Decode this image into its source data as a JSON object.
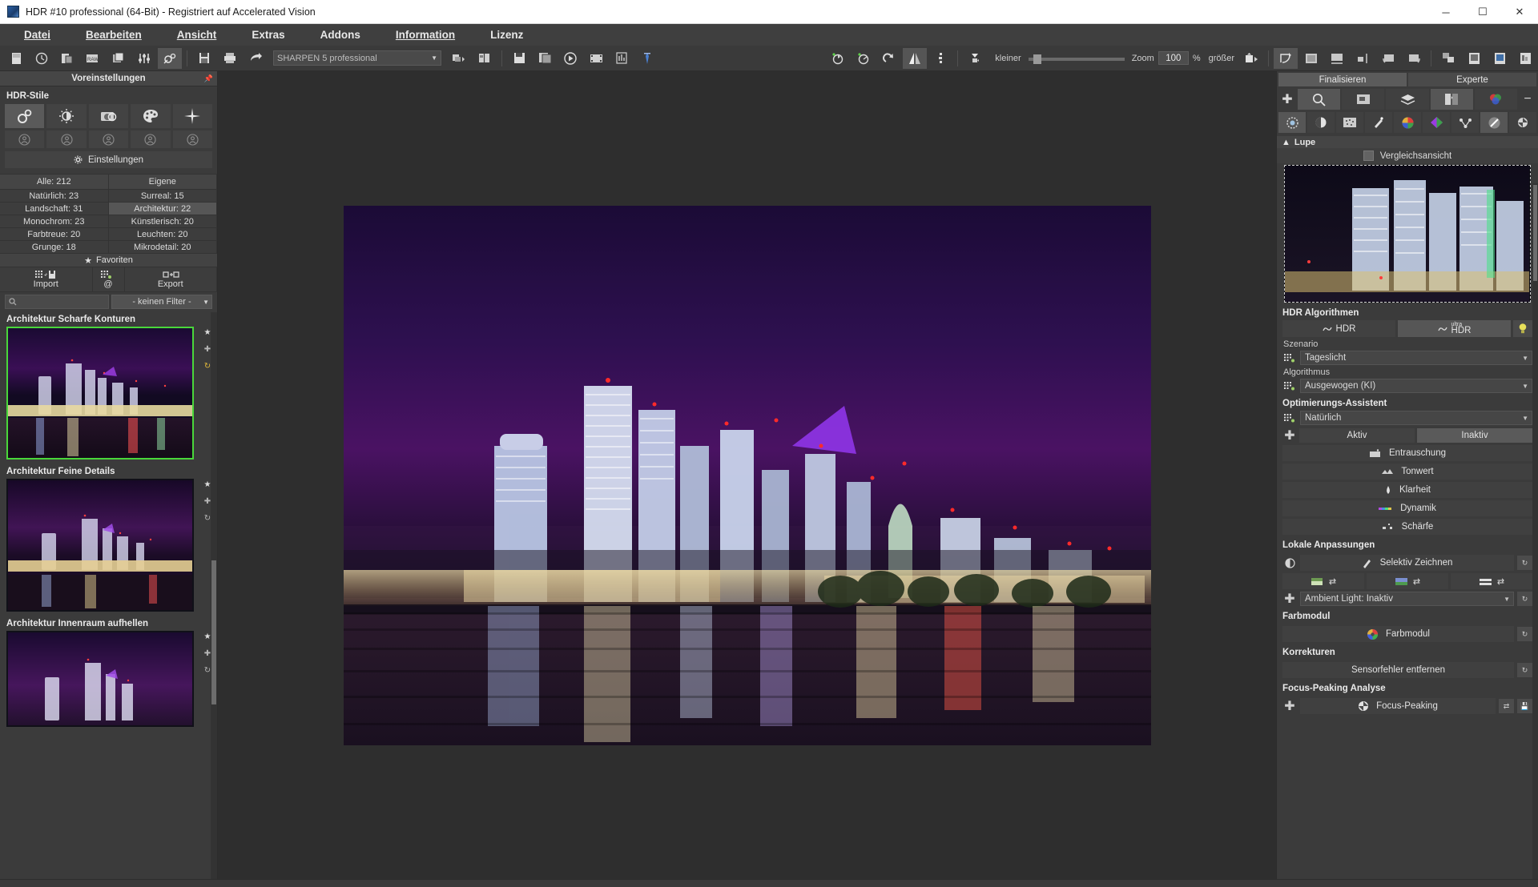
{
  "window": {
    "title": "HDR #10 professional (64-Bit) - Registriert auf Accelerated Vision",
    "icon": "app-icon",
    "minimize": "─",
    "maximize": "☐",
    "close": "✕"
  },
  "menubar": {
    "items": [
      {
        "label": "Datei",
        "accel": "D"
      },
      {
        "label": "Bearbeiten",
        "accel": "B"
      },
      {
        "label": "Ansicht",
        "accel": "A"
      },
      {
        "label": "Extras",
        "accel": "E"
      },
      {
        "label": "Addons",
        "accel": "A"
      },
      {
        "label": "Information",
        "accel": "I"
      },
      {
        "label": "Lizenz",
        "accel": "L"
      }
    ]
  },
  "toolbar": {
    "left_icons": [
      "new-document-icon",
      "open-recent-icon",
      "batch-icon",
      "raw-icon",
      "multi-image-icon",
      "adjust-sliders-icon",
      "effects-icon",
      "save-icon",
      "print-icon",
      "share-icon"
    ],
    "preset_combo": {
      "value": "SHARPEN 5 professional",
      "arrow": "▼"
    },
    "mid_icons": [
      "export-stack-icon",
      "compare-icon",
      "save-as-icon",
      "save-copy-icon",
      "play-icon",
      "film-icon",
      "histogram-panel-icon",
      "color-picker-icon"
    ],
    "right_icons": [
      "rotate-left-icon",
      "rotate-right-icon",
      "redo-icon",
      "flip-horizontal-icon",
      "split-icon",
      "crop-mask-icon"
    ],
    "zoom": {
      "smaller_label": "kleiner",
      "zoom_label": "Zoom",
      "value": "100",
      "unit": "%",
      "bigger_label": "größer"
    },
    "far_right_icons": [
      "fit-rotate-icon",
      "fit-screen-icon",
      "fit-width-icon",
      "fit-height-icon",
      "pan-left-icon",
      "pan-right-icon",
      "duplicate-icon",
      "image-a-icon",
      "image-b-icon",
      "image-c-icon"
    ]
  },
  "left_panel": {
    "header": "Voreinstellungen",
    "pin_icon": "pin-icon",
    "hdr_styles": {
      "title": "HDR-Stile",
      "row1": [
        {
          "name": "gears-icon",
          "selected": true
        },
        {
          "name": "contrast-icon",
          "selected": false
        },
        {
          "name": "camera-icon",
          "selected": false
        },
        {
          "name": "palette-icon",
          "selected": false
        },
        {
          "name": "sparkle-icon",
          "selected": false
        }
      ],
      "row2": [
        {
          "name": "user-preset-icon"
        },
        {
          "name": "user-preset-icon"
        },
        {
          "name": "user-preset-icon"
        },
        {
          "name": "user-preset-icon"
        },
        {
          "name": "user-preset-icon"
        }
      ]
    },
    "settings_button": {
      "label": "Einstellungen",
      "icon": "gear-icon"
    },
    "categories": [
      {
        "left": "Alle: 212",
        "right": "Eigene",
        "header": true,
        "left_hl": false,
        "right_hl": false
      },
      {
        "left": "Natürlich: 23",
        "right": "Surreal: 15",
        "left_hl": false,
        "right_hl": false
      },
      {
        "left": "Landschaft: 31",
        "right": "Architektur: 22",
        "left_hl": false,
        "right_hl": true
      },
      {
        "left": "Monochrom: 23",
        "right": "Künstlerisch: 20",
        "left_hl": false,
        "right_hl": false
      },
      {
        "left": "Farbtreue: 20",
        "right": "Leuchten: 20",
        "left_hl": false,
        "right_hl": false
      },
      {
        "left": "Grunge: 18",
        "right": "Mikrodetail: 20",
        "left_hl": false,
        "right_hl": false
      }
    ],
    "favorites": {
      "label": "Favoriten",
      "icon": "star-icon"
    },
    "io": {
      "import": {
        "label": "Import",
        "icon": "import-icon"
      },
      "middle": {
        "label": "@",
        "icon": "at-icon"
      },
      "export": {
        "label": "Export",
        "icon": "export-icon"
      }
    },
    "search": {
      "placeholder": "",
      "value": "",
      "icon": "search-icon"
    },
    "filter": {
      "value": "- keinen Filter -",
      "arrow": "▼"
    },
    "presets": [
      {
        "name": "Architektur Scharfe Konturen",
        "selected": true
      },
      {
        "name": "Architektur Feine Details",
        "selected": false
      },
      {
        "name": "Architektur Innenraum aufhellen",
        "selected": false
      }
    ],
    "preset_actions": [
      "favorite-star-icon",
      "add-icon",
      "reset-icon"
    ]
  },
  "right_panel": {
    "mode_tabs": [
      {
        "label": "Finalisieren",
        "selected": true
      },
      {
        "label": "Experte",
        "selected": false
      }
    ],
    "tool_row1": [
      "plus-icon",
      "magnifier-icon",
      "preview-icon",
      "layers-icon",
      "compare-split-icon",
      "color-wheel-icon",
      "minus-icon"
    ],
    "tool_row2": [
      "settings-gear-icon",
      "contrast-half-icon",
      "noise-icon",
      "retouch-wand-icon",
      "color-circle-icon",
      "color-triangle-icon",
      "node-graph-icon",
      "sharpen-icon",
      "refresh-icon"
    ],
    "lupe": {
      "title": "Lupe",
      "collapse_icon": "caret-up-icon",
      "compare_label": "Vergleichsansicht",
      "compare_checked": false
    },
    "hdr_algorithms": {
      "title": "HDR Algorithmen",
      "buttons": [
        {
          "label": "HDR",
          "selected": false,
          "icon": "hdr-icon"
        },
        {
          "label": "HDR",
          "sup": "ultra",
          "selected": true,
          "icon": "ultra-hdr-icon"
        }
      ],
      "bulb_icon": "lightbulb-icon",
      "scenario_label": "Szenario",
      "scenario_value": "Tageslicht",
      "algorithm_label": "Algorithmus",
      "algorithm_value": "Ausgewogen (KI)"
    },
    "optimizer": {
      "title": "Optimierungs-Assistent",
      "value": "Natürlich",
      "toggle_icon": "refresh-small-icon",
      "active_label": "Aktiv",
      "inactive_label": "Inaktiv",
      "active_selected": false,
      "inactive_selected": true,
      "actions": [
        {
          "label": "Entrauschung",
          "icon": "denoise-icon"
        },
        {
          "label": "Tonwert",
          "icon": "tonal-icon"
        },
        {
          "label": "Klarheit",
          "icon": "clarity-icon"
        },
        {
          "label": "Dynamik",
          "icon": "vibrance-icon"
        },
        {
          "label": "Schärfe",
          "icon": "sharpness-icon"
        }
      ]
    },
    "local_adjustments": {
      "title": "Lokale Anpassungen",
      "left_icon": "half-circle-icon",
      "selective_label": "Selektiv Zeichnen",
      "reset_icon": "reset-icon",
      "triple_icons": [
        "gradient-linear-icon",
        "gradient-sky-icon",
        "gradient-band-icon"
      ],
      "ambient": {
        "label": "Ambient Light: Inaktiv",
        "icon": "refresh-small-icon",
        "arrow": "▼",
        "reset_icon": "reset-icon"
      }
    },
    "color_module": {
      "title": "Farbmodul",
      "label": "Farbmodul",
      "icon": "color-wheel-icon",
      "reset_icon": "reset-icon"
    },
    "corrections": {
      "title": "Korrekturen",
      "label": "Sensorfehler entfernen",
      "reset_icon": "reset-icon"
    },
    "focus_peaking": {
      "title": "Focus-Peaking Analyse",
      "label": "Focus-Peaking",
      "icon": "focus-peaking-icon",
      "left_icon": "refresh-small-icon",
      "right_icons": [
        "band-swap-icon",
        "save-state-icon"
      ]
    }
  },
  "colors": {
    "accent_green": "#49d73a",
    "panel_bg": "#3b3b3b",
    "toolbar_bg": "#3a3a3a",
    "canvas_bg": "#2e2e2e",
    "text": "#e2e2e2"
  }
}
